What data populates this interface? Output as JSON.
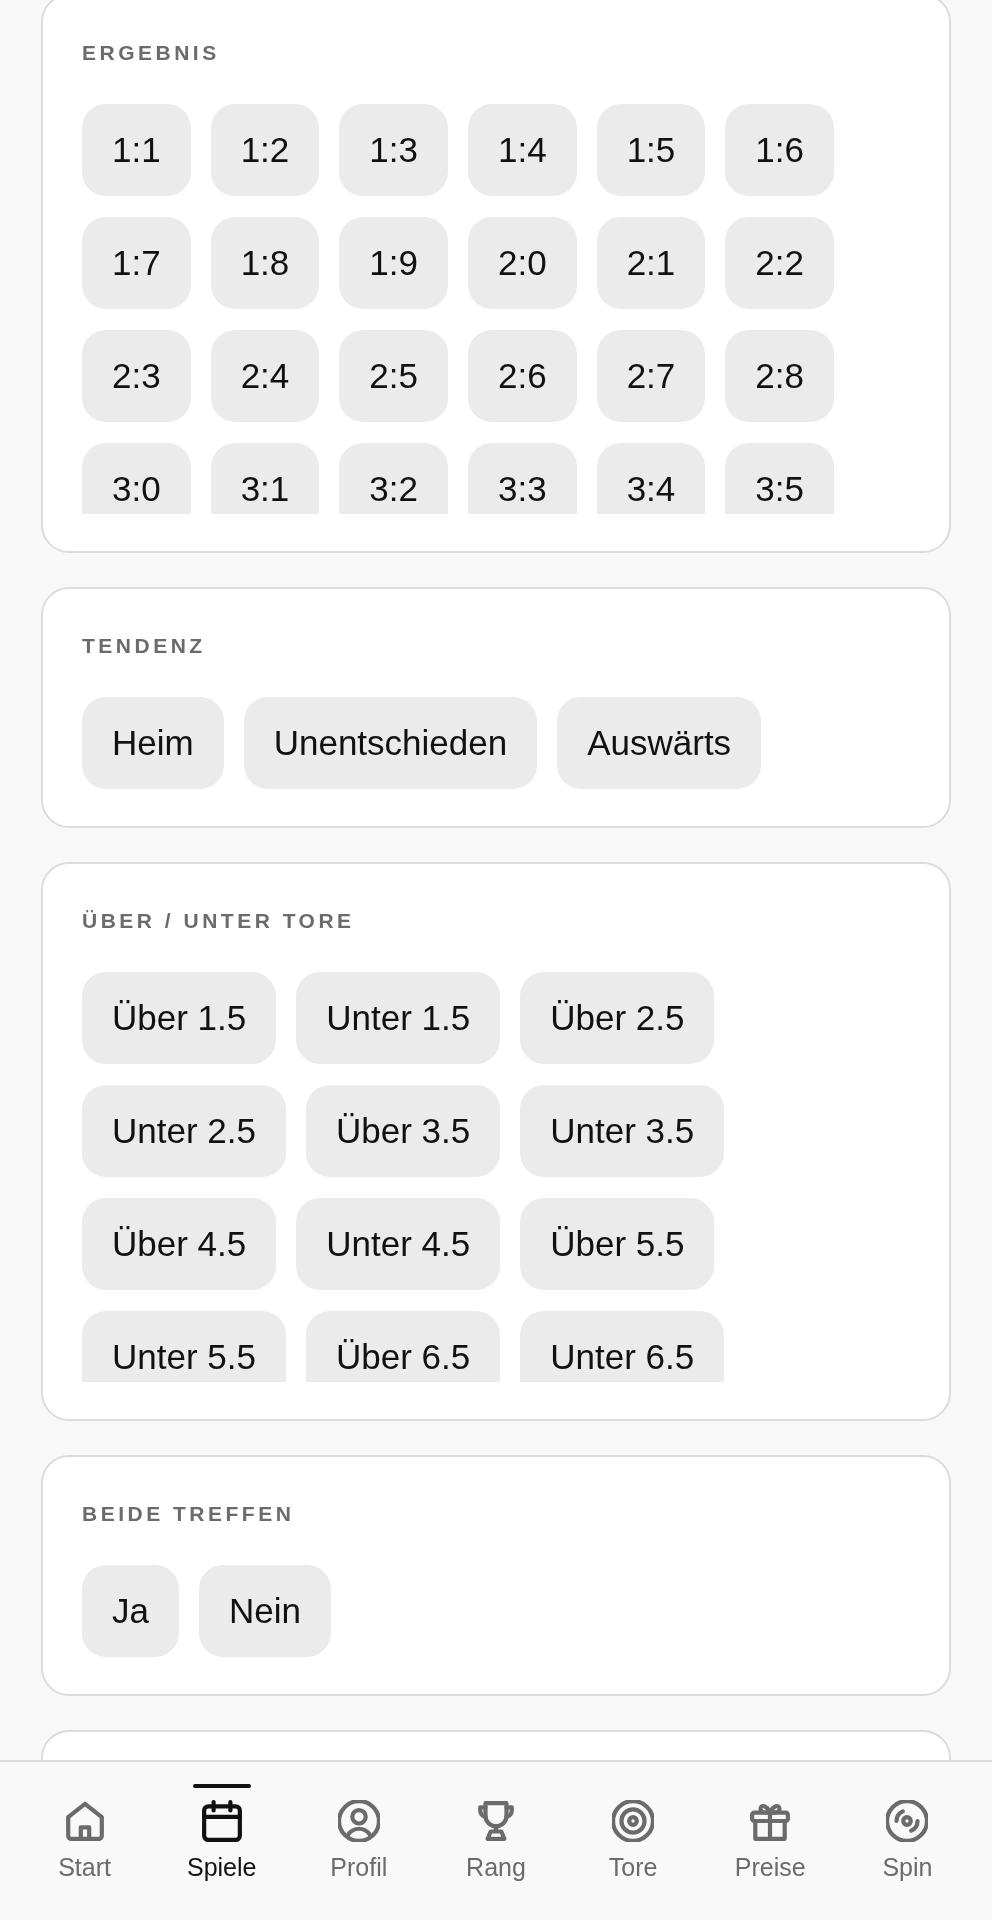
{
  "sections": [
    {
      "title": "ERGEBNIS",
      "options": [
        {
          "label": "1:1",
          "selected": false
        },
        {
          "label": "1:2",
          "selected": false
        },
        {
          "label": "1:3",
          "selected": false
        },
        {
          "label": "1:4",
          "selected": false
        },
        {
          "label": "1:5",
          "selected": false
        },
        {
          "label": "1:6",
          "selected": false
        },
        {
          "label": "1:7",
          "selected": false
        },
        {
          "label": "1:8",
          "selected": false
        },
        {
          "label": "1:9",
          "selected": false
        },
        {
          "label": "2:0",
          "selected": false
        },
        {
          "label": "2:1",
          "selected": false
        },
        {
          "label": "2:2",
          "selected": false
        },
        {
          "label": "2:3",
          "selected": false
        },
        {
          "label": "2:4",
          "selected": false
        },
        {
          "label": "2:5",
          "selected": false
        },
        {
          "label": "2:6",
          "selected": false
        },
        {
          "label": "2:7",
          "selected": false
        },
        {
          "label": "2:8",
          "selected": false
        },
        {
          "label": "3:0",
          "selected": false
        },
        {
          "label": "3:1",
          "selected": false
        },
        {
          "label": "3:2",
          "selected": false
        },
        {
          "label": "3:3",
          "selected": false
        },
        {
          "label": "3:4",
          "selected": false
        },
        {
          "label": "3:5",
          "selected": false
        }
      ]
    },
    {
      "title": "TENDENZ",
      "options": [
        {
          "label": "Heim",
          "selected": false
        },
        {
          "label": "Unentschieden",
          "selected": false
        },
        {
          "label": "Auswärts",
          "selected": false
        }
      ]
    },
    {
      "title": "ÜBER / UNTER TORE",
      "options": [
        {
          "label": "Über 1.5",
          "selected": false
        },
        {
          "label": "Unter 1.5",
          "selected": false
        },
        {
          "label": "Über 2.5",
          "selected": false
        },
        {
          "label": "Unter 2.5",
          "selected": false
        },
        {
          "label": "Über 3.5",
          "selected": false
        },
        {
          "label": "Unter 3.5",
          "selected": false
        },
        {
          "label": "Über 4.5",
          "selected": false
        },
        {
          "label": "Unter 4.5",
          "selected": false
        },
        {
          "label": "Über 5.5",
          "selected": false
        },
        {
          "label": "Unter 5.5",
          "selected": false
        },
        {
          "label": "Über 6.5",
          "selected": false
        },
        {
          "label": "Unter 6.5",
          "selected": false
        }
      ]
    },
    {
      "title": "BEIDE TREFFEN",
      "options": [
        {
          "label": "Ja",
          "selected": false
        },
        {
          "label": "Nein",
          "selected": false
        }
      ]
    }
  ],
  "more_sections_below": true,
  "nav": {
    "items": [
      {
        "label": "Start",
        "selected": false
      },
      {
        "label": "Spiele",
        "selected": true
      },
      {
        "label": "Profil",
        "selected": false
      },
      {
        "label": "Rang",
        "selected": false
      },
      {
        "label": "Tore",
        "selected": false
      },
      {
        "label": "Preise",
        "selected": false
      },
      {
        "label": "Spin",
        "selected": false
      }
    ]
  }
}
